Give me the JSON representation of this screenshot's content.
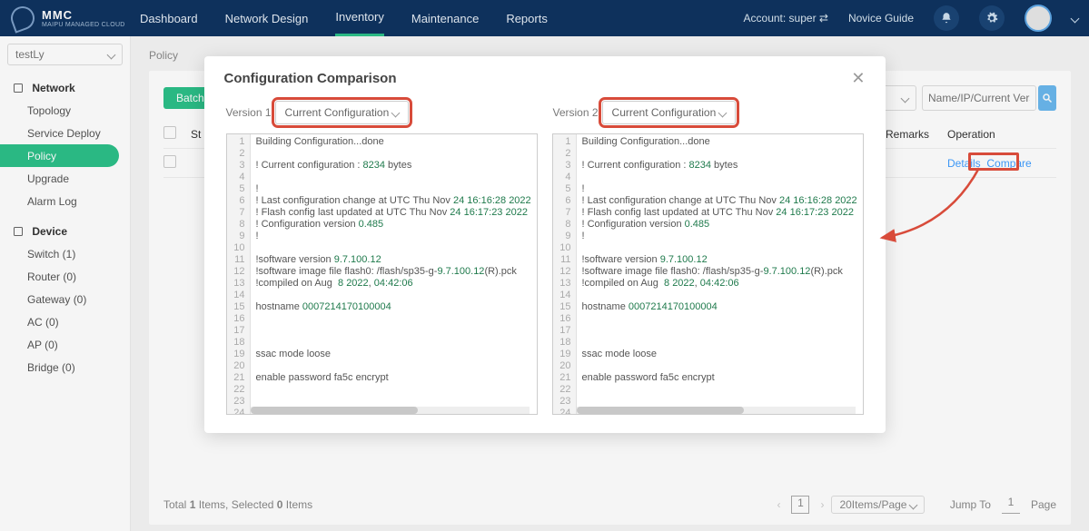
{
  "brand": {
    "name": "MMC",
    "tag": "MAIPU MANAGED CLOUD"
  },
  "nav": {
    "items": [
      "Dashboard",
      "Network Design",
      "Inventory",
      "Maintenance",
      "Reports"
    ],
    "active": 2
  },
  "account": {
    "label": "Account: super ⇄",
    "guide": "Novice Guide"
  },
  "env": {
    "name": "testLy"
  },
  "sidebar": {
    "network": {
      "head": "Network",
      "items": [
        "Topology",
        "Service Deploy",
        "Policy",
        "Upgrade",
        "Alarm Log"
      ],
      "active": 2
    },
    "device": {
      "head": "Device",
      "items": [
        "Switch (1)",
        "Router (0)",
        "Gateway (0)",
        "AC (0)",
        "AP (0)",
        "Bridge (0)"
      ]
    }
  },
  "crumb": "Policy",
  "toolbar": {
    "batch": "Batch Ba",
    "search_ph": "Name/IP/Current Version"
  },
  "table": {
    "headers": {
      "st": "St",
      "remarks": "Remarks",
      "op": "Operation"
    },
    "row": {
      "details": "Details",
      "compare": "Compare"
    }
  },
  "footer": {
    "total_a": "Total ",
    "total_n": "1",
    "total_b": " Items, Selected ",
    "sel_n": "0",
    "total_c": " Items",
    "page_n": "1",
    "per": "20Items/Page",
    "jump": "Jump To",
    "jump_n": "1",
    "pg": "Page"
  },
  "modal": {
    "title": "Configuration Comparison",
    "v1": "Version 1",
    "v2": "Version 2",
    "sel": "Current Configuration",
    "lines": [
      "Building Configuration...done",
      "",
      "! Current configuration : 8234 bytes",
      "",
      "!",
      "! Last configuration change at UTC Thu Nov 24 16:16:28 2022",
      "! Flash config last updated at UTC Thu Nov 24 16:17:23 2022",
      "! Configuration version 0.485",
      "!",
      "",
      "!software version 9.7.100.12",
      "!software image file flash0: /flash/sp35-g-9.7.100.12(R).pck",
      "!compiled on Aug  8 2022, 04:42:06",
      "",
      "hostname 0007214170100004",
      "",
      "",
      "",
      "ssac mode loose",
      "",
      "enable password fa5c encrypt",
      "",
      "",
      ""
    ]
  }
}
